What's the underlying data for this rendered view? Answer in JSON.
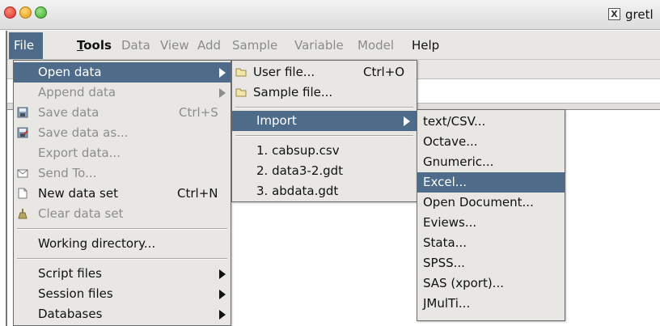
{
  "titlebar": {
    "title": "gretl",
    "x11_glyph": "X"
  },
  "menubar": {
    "items": [
      "File",
      "Tools",
      "Data",
      "View",
      "Add",
      "Sample",
      "Variable",
      "Model",
      "Help"
    ],
    "selected": "File"
  },
  "file_menu": {
    "items": [
      {
        "label": "Open data",
        "accel": "",
        "submenu": true,
        "state": "selected",
        "icon": ""
      },
      {
        "label": "Append data",
        "accel": "",
        "submenu": true,
        "state": "disabled",
        "icon": ""
      },
      {
        "label": "Save data",
        "accel": "Ctrl+S",
        "submenu": false,
        "state": "disabled",
        "icon": "save-icon"
      },
      {
        "label": "Save data as...",
        "accel": "",
        "submenu": false,
        "state": "disabled",
        "icon": "save-as-icon"
      },
      {
        "label": "Export data...",
        "accel": "",
        "submenu": false,
        "state": "disabled",
        "icon": ""
      },
      {
        "label": "Send To...",
        "accel": "",
        "submenu": false,
        "state": "disabled",
        "icon": "mail-icon"
      },
      {
        "label": "New data set",
        "accel": "Ctrl+N",
        "submenu": false,
        "state": "normal",
        "icon": "new-document-icon"
      },
      {
        "label": "Clear data set",
        "accel": "",
        "submenu": false,
        "state": "disabled",
        "icon": "clear-icon"
      },
      {
        "label": "Working directory...",
        "accel": "",
        "submenu": false,
        "state": "normal",
        "icon": ""
      },
      {
        "label": "Script files",
        "accel": "",
        "submenu": true,
        "state": "normal",
        "icon": ""
      },
      {
        "label": "Session files",
        "accel": "",
        "submenu": true,
        "state": "normal",
        "icon": ""
      },
      {
        "label": "Databases",
        "accel": "",
        "submenu": true,
        "state": "normal",
        "icon": ""
      }
    ]
  },
  "open_data_menu": {
    "items": [
      {
        "label": "User file...",
        "accel": "Ctrl+O",
        "icon": "folder-icon"
      },
      {
        "label": "Sample file...",
        "accel": "",
        "icon": "folder-icon"
      },
      {
        "label": "Import",
        "accel": "",
        "submenu": true,
        "state": "selected"
      },
      {
        "label": "1. cabsup.csv"
      },
      {
        "label": "2. data3-2.gdt"
      },
      {
        "label": "3. abdata.gdt"
      }
    ]
  },
  "import_menu": {
    "items": [
      "text/CSV...",
      "Octave...",
      "Gnumeric...",
      "Excel...",
      "Open Document...",
      "Eviews...",
      "Stata...",
      "SPSS...",
      "SAS (xport)...",
      "JMulTi..."
    ],
    "selected": "Excel..."
  },
  "colors": {
    "selection": "#4e6b8a",
    "menu_bg": "#e8e7e4",
    "disabled_text": "#8d8d8d"
  }
}
